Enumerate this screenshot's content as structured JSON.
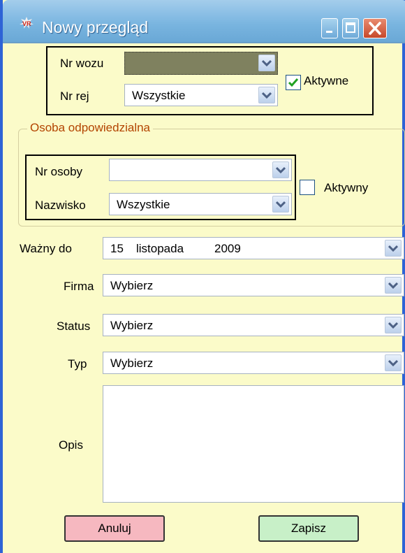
{
  "window": {
    "title": "Nowy przegląd"
  },
  "vehicle": {
    "nr_wozu_label": "Nr wozu",
    "nr_wozu_value": "",
    "nr_rej_label": "Nr rej",
    "nr_rej_value": "Wszystkie",
    "active_label": "Aktywne",
    "active_checked": true
  },
  "person": {
    "group_title": "Osoba odpowiedzialna",
    "nr_osoby_label": "Nr osoby",
    "nr_osoby_value": "",
    "nazwisko_label": "Nazwisko",
    "nazwisko_value": "Wszystkie",
    "active_label": "Aktywny",
    "active_checked": false
  },
  "form": {
    "valid_label": "Ważny do",
    "valid_day": "15",
    "valid_month": "listopada",
    "valid_year": "2009",
    "company_label": "Firma",
    "company_value": "Wybierz",
    "status_label": "Status",
    "status_value": "Wybierz",
    "type_label": "Typ",
    "type_value": "Wybierz",
    "description_label": "Opis",
    "description_value": ""
  },
  "buttons": {
    "cancel": "Anuluj",
    "save": "Zapisz"
  },
  "colors": {
    "window_bg": "#fbfbc9",
    "titlebar": "#8dc0e6",
    "cancel_bg": "#f6b8c0",
    "save_bg": "#c8f0c8",
    "group_title": "#b34400"
  },
  "icons": {
    "app": "app-logo-icon",
    "minimize": "minimize-icon",
    "maximize": "maximize-icon",
    "close": "close-icon",
    "dropdown": "chevron-down-icon",
    "check": "checkmark-icon"
  }
}
